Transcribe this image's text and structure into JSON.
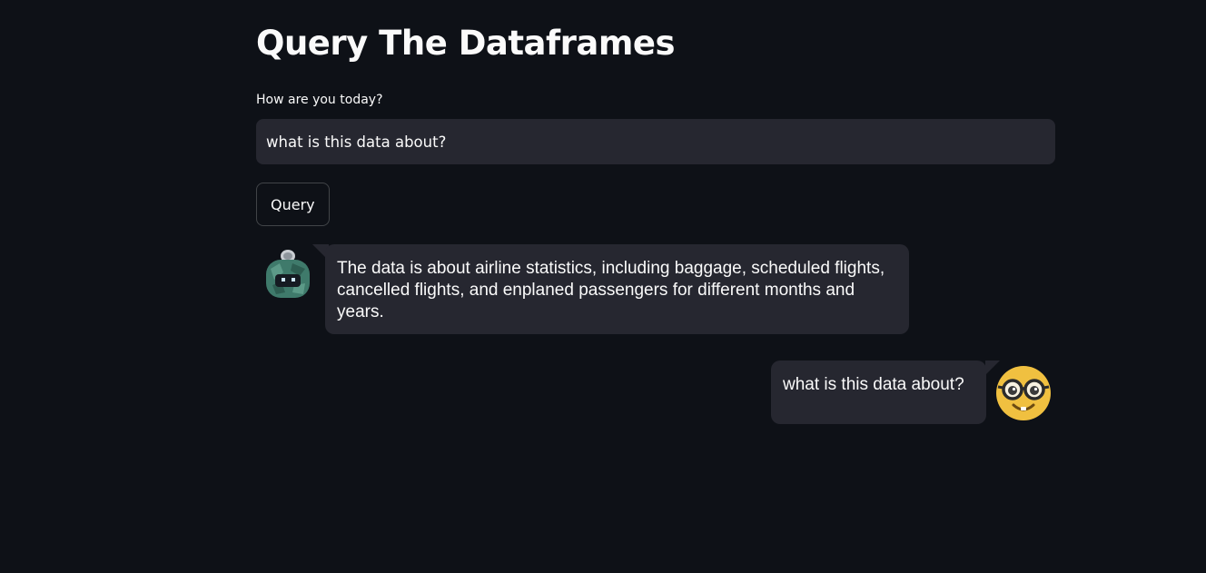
{
  "page": {
    "title": "Query The Dataframes"
  },
  "query_form": {
    "label": "How are you today?",
    "input_value": "what is this data about?",
    "button_label": "Query"
  },
  "messages": [
    {
      "role": "bot",
      "avatar_icon": "robot-avatar-icon",
      "text": "The data is about airline statistics, including baggage, scheduled flights, cancelled flights, and enplaned passengers for different months and years."
    },
    {
      "role": "user",
      "avatar_icon": "nerd-face-avatar-icon",
      "text": "what is this data about?"
    }
  ],
  "colors": {
    "background": "#0e1117",
    "surface": "#262730",
    "text": "#fafafa",
    "user_avatar": "#f0c040",
    "bot_avatar": "#3f7a6b"
  }
}
